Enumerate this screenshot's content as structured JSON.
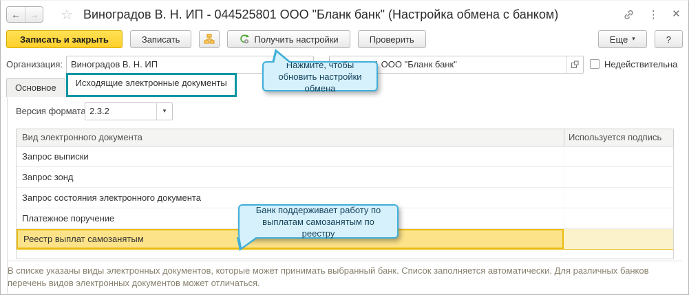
{
  "window": {
    "title": "Виноградов В. Н. ИП - 044525801 ООО \"Бланк банк\" (Настройка обмена с банком)"
  },
  "titlebar": {
    "back_glyph": "←",
    "forward_glyph": "→",
    "star_glyph": "☆",
    "dots_glyph": "⋮",
    "close_glyph": "×"
  },
  "toolbar": {
    "save_close_label": "Записать и закрыть",
    "save_label": "Записать",
    "get_settings_label": "Получить настройки",
    "check_label": "Проверить",
    "more_label": "Еще",
    "more_arrow": "▾",
    "help_label": "?"
  },
  "form": {
    "organization_label": "Организация:",
    "organization_value": "Виноградов В. Н. ИП",
    "bank_account_value": "044525801 ООО \"Бланк банк\"",
    "invalid_label": "Недействительна"
  },
  "tabs": {
    "main": "Основное",
    "outgoing": "Исходящие электронные документы"
  },
  "content": {
    "format_version_label": "Версия формата:",
    "format_version_value": "2.3.2",
    "dropdown_arrow": "▾",
    "table": {
      "columns": [
        "Вид электронного документа",
        "Используется подпись"
      ],
      "rows": [
        {
          "name": "Запрос выписки",
          "signature": "",
          "highlighted": false
        },
        {
          "name": "Запрос зонд",
          "signature": "",
          "highlighted": false
        },
        {
          "name": "Запрос состояния электронного документа",
          "signature": "",
          "highlighted": false
        },
        {
          "name": "Платежное поручение",
          "signature": "",
          "highlighted": false
        },
        {
          "name": "Реестр выплат самозанятым",
          "signature": "",
          "highlighted": true
        }
      ]
    },
    "hint": "В списке указаны виды электронных документов, которые может принимать выбранный банк. Список заполняется автоматически. Для различных банков перечень видов электронных документов может отличаться."
  },
  "tooltips": {
    "get_settings": "Нажмите, чтобы обновить настройки обмена",
    "selfemployed_registry": "Банк поддерживает работу по выплатам самозанятым по реестру"
  },
  "icons": {
    "org_structure": "org-structure-icon",
    "refresh_settings": "refresh-gear-icon",
    "link": "link-icon",
    "open_field": "open-icon"
  },
  "colors": {
    "accent_teal": "#0b96a3",
    "primary_button_yellow": "#fecf2c",
    "row_highlight_fill": "#fce289",
    "row_highlight_border": "#e9bb10",
    "tooltip_fill": "#d6f1fc",
    "tooltip_border": "#40aed9"
  }
}
